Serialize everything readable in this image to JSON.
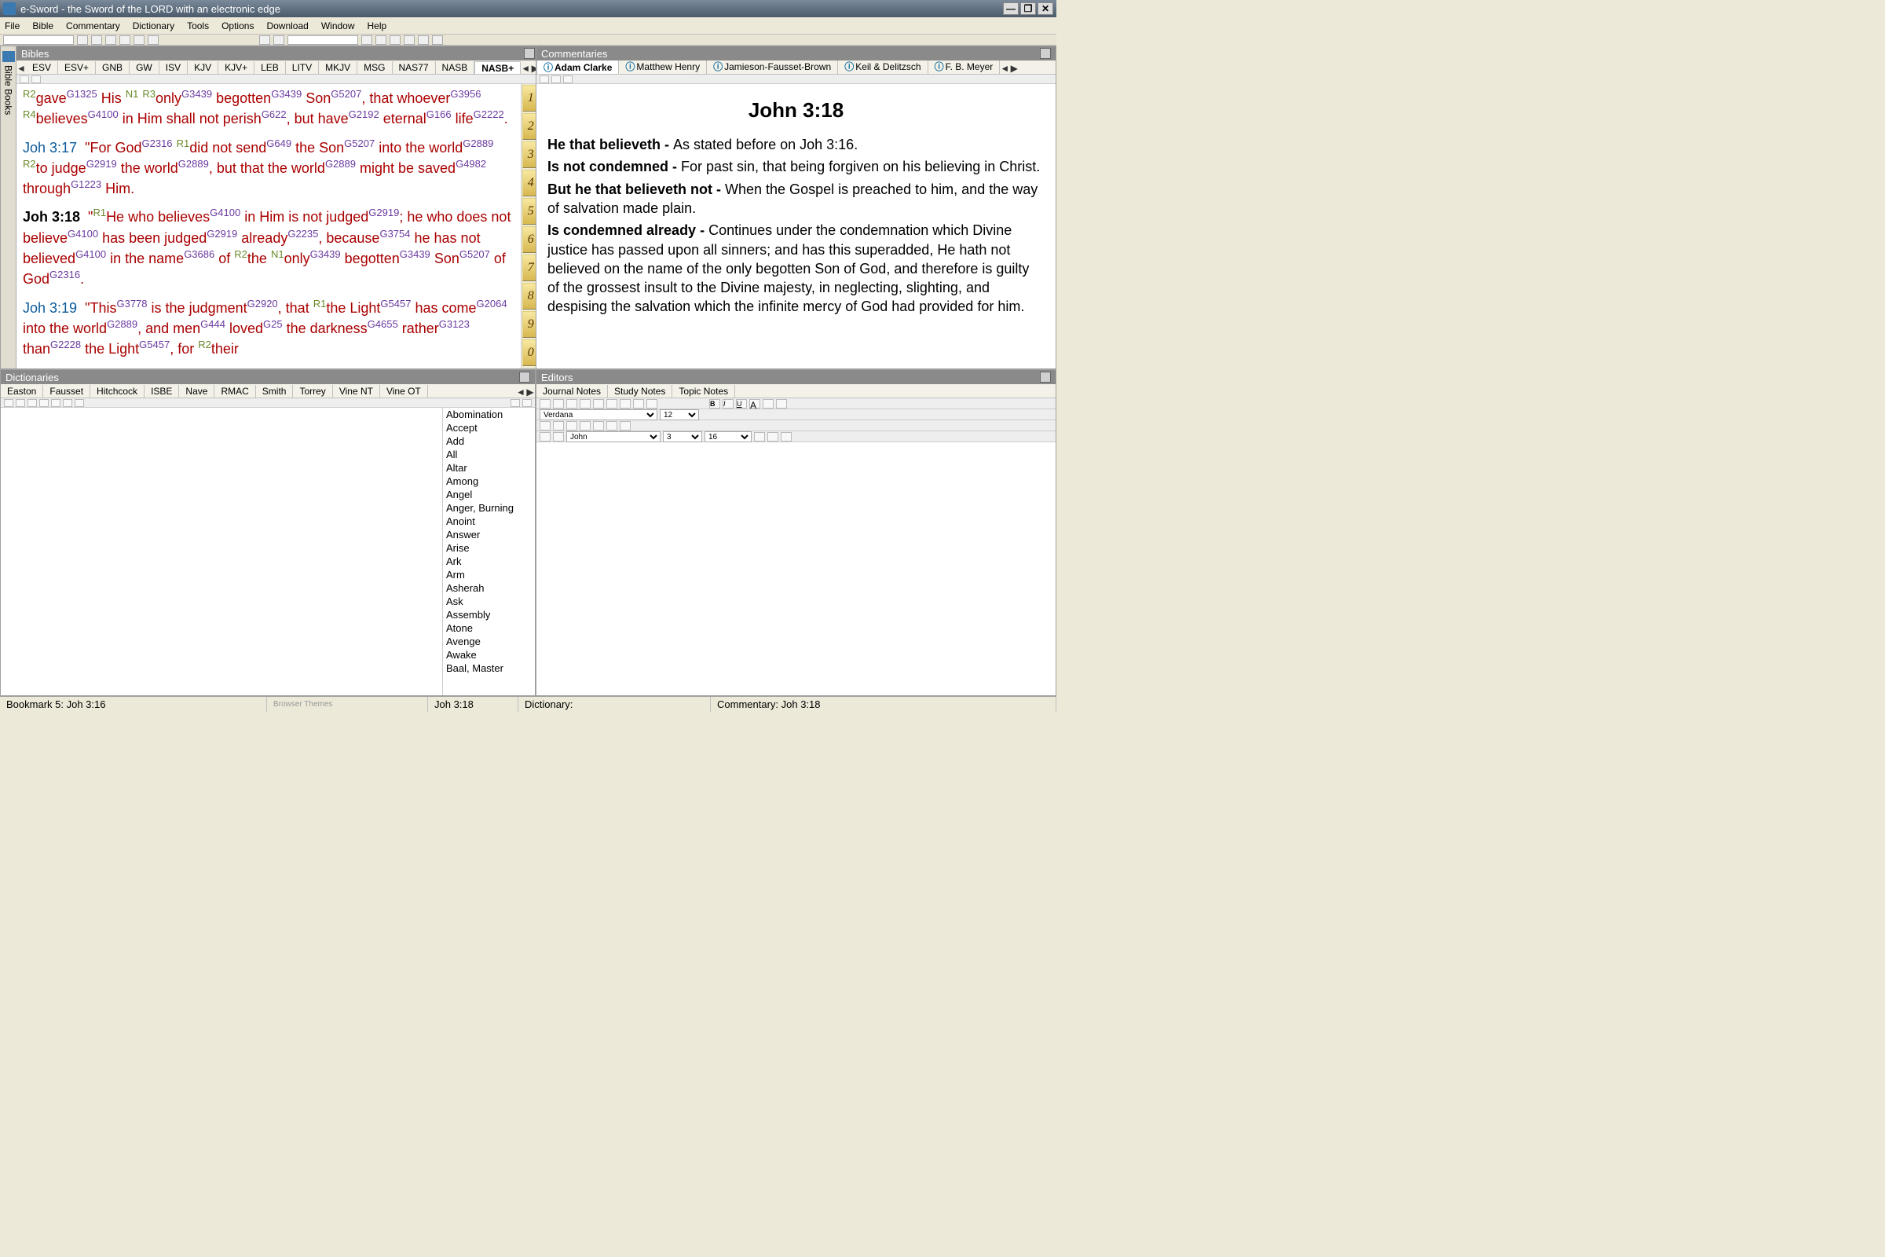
{
  "title": "e-Sword - the Sword of the LORD with an electronic edge",
  "menu": [
    "File",
    "Bible",
    "Commentary",
    "Dictionary",
    "Tools",
    "Options",
    "Download",
    "Window",
    "Help"
  ],
  "panels": {
    "bibles": {
      "title": "Bibles",
      "sidetab": "Bible Books",
      "tabs": [
        "ESV",
        "ESV+",
        "GNB",
        "GW",
        "ISV",
        "KJV",
        "KJV+",
        "LEB",
        "LITV",
        "MKJV",
        "MSG",
        "NAS77",
        "NASB",
        "NASB+"
      ],
      "chapters": [
        "1",
        "2",
        "3",
        "4",
        "5",
        "6",
        "7",
        "8",
        "9",
        "0"
      ]
    },
    "commentaries": {
      "title": "Commentaries",
      "tabs": [
        "Adam Clarke",
        "Matthew Henry",
        "Jamieson-Fausset-Brown",
        "Keil & Delitzsch",
        "F. B. Meyer"
      ],
      "heading": "John 3:18",
      "paras": [
        {
          "b": "He that believeth - ",
          "t": "As stated before on Joh 3:16."
        },
        {
          "b": "Is not condemned - ",
          "t": "For past sin, that being forgiven on his believing in Christ."
        },
        {
          "b": "But he that believeth not - ",
          "t": "When the Gospel is preached to him, and the way of salvation made plain."
        },
        {
          "b": "Is condemned already - ",
          "t": "Continues under the condemnation which Divine justice has passed upon all sinners; and has this superadded, He hath not believed on the name of the only begotten Son of God, and therefore is guilty of the grossest insult to the Divine majesty, in neglecting, slighting, and despising the salvation which the infinite mercy of God had provided for him."
        }
      ]
    },
    "dictionaries": {
      "title": "Dictionaries",
      "tabs": [
        "Easton",
        "Fausset",
        "Hitchcock",
        "ISBE",
        "Nave",
        "RMAC",
        "Smith",
        "Torrey",
        "Vine NT",
        "Vine OT"
      ],
      "words": [
        "Abomination",
        "Accept",
        "Add",
        "All",
        "Altar",
        "Among",
        "Angel",
        "Anger, Burning",
        "Anoint",
        "Answer",
        "Arise",
        "Ark",
        "Arm",
        "Asherah",
        "Ask",
        "Assembly",
        "Atone",
        "Avenge",
        "Awake",
        "Baal, Master"
      ]
    },
    "editors": {
      "title": "Editors",
      "tabs": [
        "Journal Notes",
        "Study Notes",
        "Topic Notes"
      ],
      "font": "Verdana",
      "size": "12",
      "book": "John",
      "chapter": "3",
      "verse": "16"
    }
  },
  "status": {
    "bookmark": "Bookmark 5: Joh 3:16",
    "browser": "Browser Themes",
    "ref": "Joh 3:18",
    "dict": "Dictionary:",
    "comm": "Commentary: Joh 3:18"
  }
}
